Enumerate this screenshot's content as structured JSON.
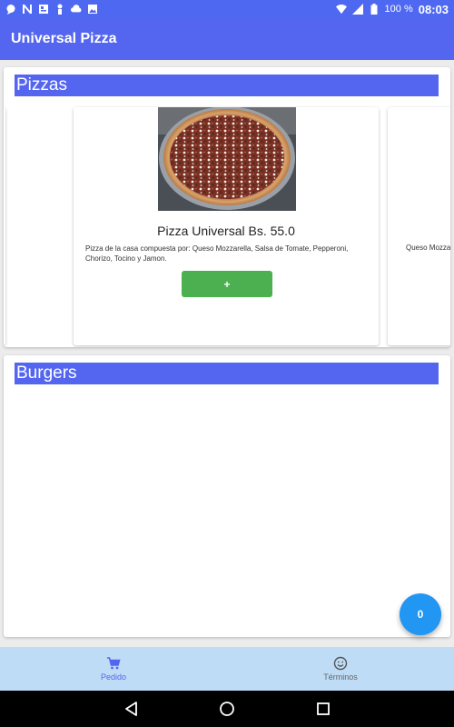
{
  "status_bar": {
    "battery": "100 %",
    "time": "08:03",
    "left_icons": [
      "chat-icon",
      "n-notification-icon",
      "news-icon",
      "person-icon",
      "cloud-icon",
      "image-icon"
    ],
    "right_icons": [
      "wifi-icon",
      "signal-icon",
      "battery-icon"
    ]
  },
  "app_bar": {
    "title": "Universal Pizza"
  },
  "sections": {
    "pizzas": {
      "title": "Pizzas",
      "items": [
        {
          "name": "Pizza Universal Bs. 55.0",
          "description": "Pizza de la casa compuesta por: Queso Mozzarella, Salsa de Tomate, Pepperoni, Chorizo, Tocino y Jamon.",
          "add_label": "+"
        }
      ],
      "peek_text": "Queso Mozza"
    },
    "burgers": {
      "title": "Burgers"
    }
  },
  "cart_fab": {
    "count": "0"
  },
  "bottom_nav": {
    "items": [
      {
        "label": "Pedido",
        "icon": "cart-icon",
        "active": true
      },
      {
        "label": "Términos",
        "icon": "smiley-icon",
        "active": false
      }
    ]
  },
  "colors": {
    "primary": "#5466f0",
    "status_bar": "#4f68f2",
    "add_button": "#4caf50",
    "fab": "#2196f3",
    "bottom_nav_bg": "#bedcf6"
  }
}
